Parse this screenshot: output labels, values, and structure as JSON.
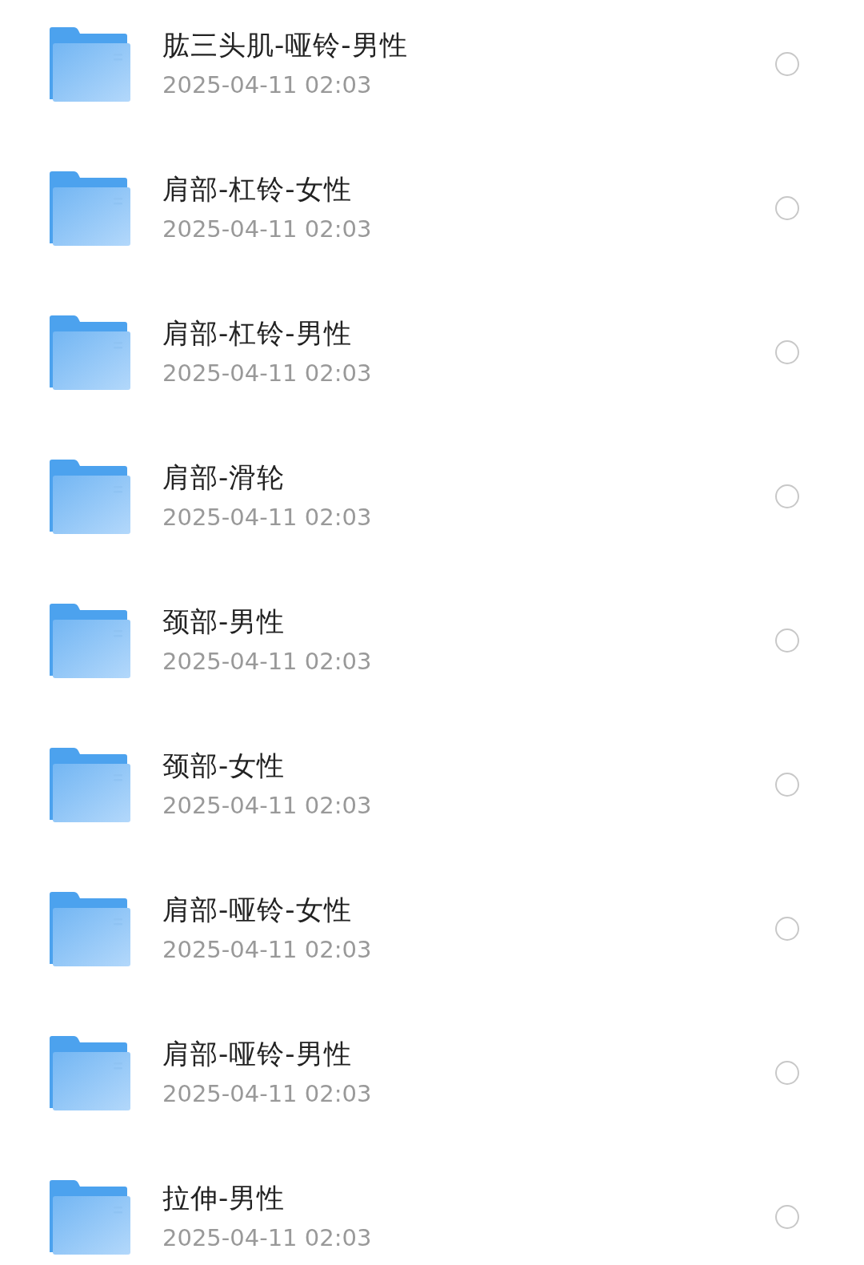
{
  "folders": [
    {
      "name": "肱三头肌-哑铃-男性",
      "modified": "2025-04-11 02:03",
      "selected": false
    },
    {
      "name": "肩部-杠铃-女性",
      "modified": "2025-04-11 02:03",
      "selected": false
    },
    {
      "name": "肩部-杠铃-男性",
      "modified": "2025-04-11 02:03",
      "selected": false
    },
    {
      "name": "肩部-滑轮",
      "modified": "2025-04-11 02:03",
      "selected": false
    },
    {
      "name": "颈部-男性",
      "modified": "2025-04-11 02:03",
      "selected": false
    },
    {
      "name": "颈部-女性",
      "modified": "2025-04-11 02:03",
      "selected": false
    },
    {
      "name": "肩部-哑铃-女性",
      "modified": "2025-04-11 02:03",
      "selected": false
    },
    {
      "name": "肩部-哑铃-男性",
      "modified": "2025-04-11 02:03",
      "selected": false
    },
    {
      "name": "拉伸-男性",
      "modified": "2025-04-11 02:03",
      "selected": false
    }
  ]
}
